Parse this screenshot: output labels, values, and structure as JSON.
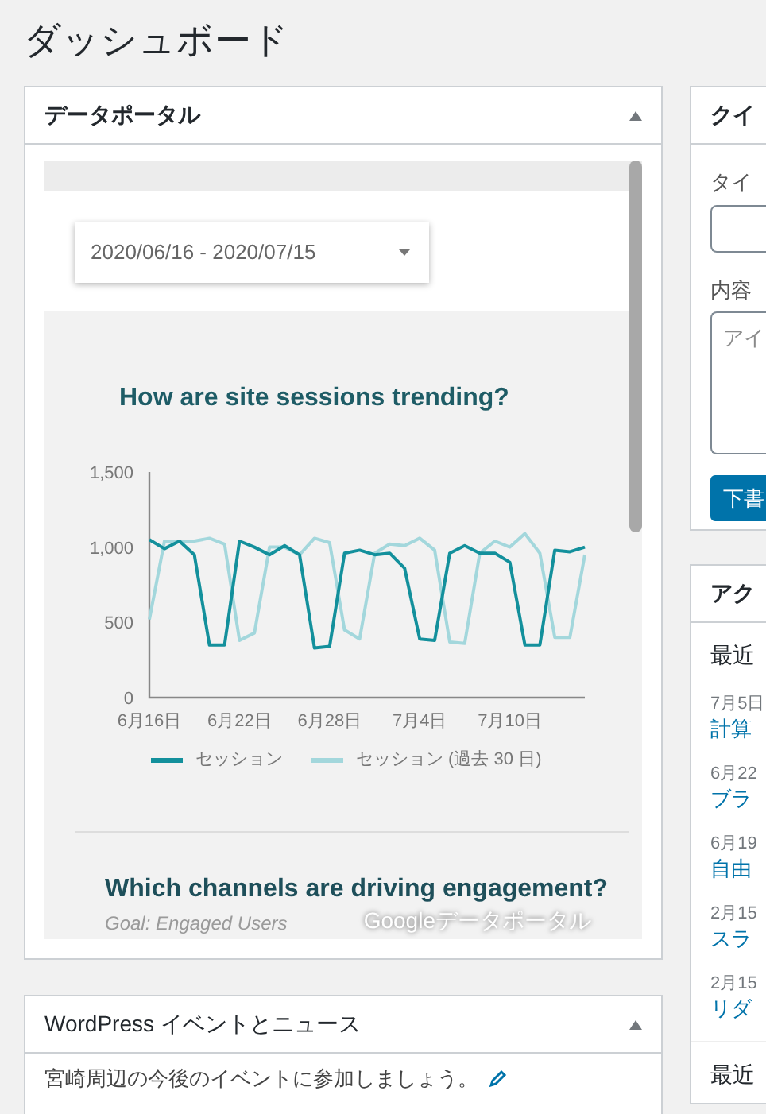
{
  "page_title": "ダッシュボード",
  "data_portal": {
    "title": "データポータル",
    "date_range": "2020/06/16 - 2020/07/15",
    "report": {
      "heading": "How are site sessions trending?",
      "chart_data": {
        "type": "line",
        "categories": [
          "6月16日",
          null,
          null,
          null,
          null,
          null,
          "6月22日",
          null,
          null,
          null,
          null,
          null,
          "6月28日",
          null,
          null,
          null,
          null,
          null,
          "7月4日",
          null,
          null,
          null,
          null,
          null,
          "7月10日",
          null,
          null,
          null,
          null,
          null
        ],
        "ylim": [
          0,
          1500
        ],
        "yticks": [
          0,
          500,
          {
            "value": 1000,
            "label": "1,000"
          },
          {
            "value": 1500,
            "label": "1,500"
          }
        ],
        "series": [
          {
            "name": "セッション",
            "color": "#13909c",
            "values": [
              1050,
              990,
              1040,
              950,
              350,
              350,
              1040,
              1000,
              950,
              1010,
              950,
              330,
              340,
              960,
              980,
              950,
              960,
              860,
              390,
              380,
              960,
              1010,
              960,
              960,
              900,
              350,
              350,
              980,
              970,
              1000
            ]
          },
          {
            "name": "セッション (過去 30 日)",
            "color": "#a3d7dc",
            "values": [
              520,
              1040,
              1040,
              1040,
              1060,
              1020,
              380,
              430,
              1000,
              1000,
              950,
              1060,
              1030,
              450,
              390,
              960,
              1020,
              1010,
              1060,
              980,
              370,
              360,
              960,
              1040,
              1000,
              1090,
              960,
              400,
              400,
              950
            ]
          }
        ]
      },
      "second_heading": "Which channels are driving engagement?",
      "goal": "Goal: Engaged Users",
      "branding": "Googleデータポータル"
    }
  },
  "events_news": {
    "title": "WordPress イベントとニュース",
    "intro": "宮崎周辺の今後のイベントに参加しましょう。"
  },
  "quick_draft": {
    "title": "クイ",
    "title_label": "タイ",
    "content_label": "内容",
    "content_placeholder": "アイ",
    "button": "下書"
  },
  "activity": {
    "title": "アク",
    "section": "最近",
    "items": [
      {
        "date": "7月5日",
        "link": "計算"
      },
      {
        "date": "6月22",
        "link": "ブラ"
      },
      {
        "date": "6月19",
        "link": "自由"
      },
      {
        "date": "2月15",
        "link": "スラ"
      },
      {
        "date": "2月15",
        "link": "リダ"
      }
    ],
    "section_2": "最近"
  }
}
